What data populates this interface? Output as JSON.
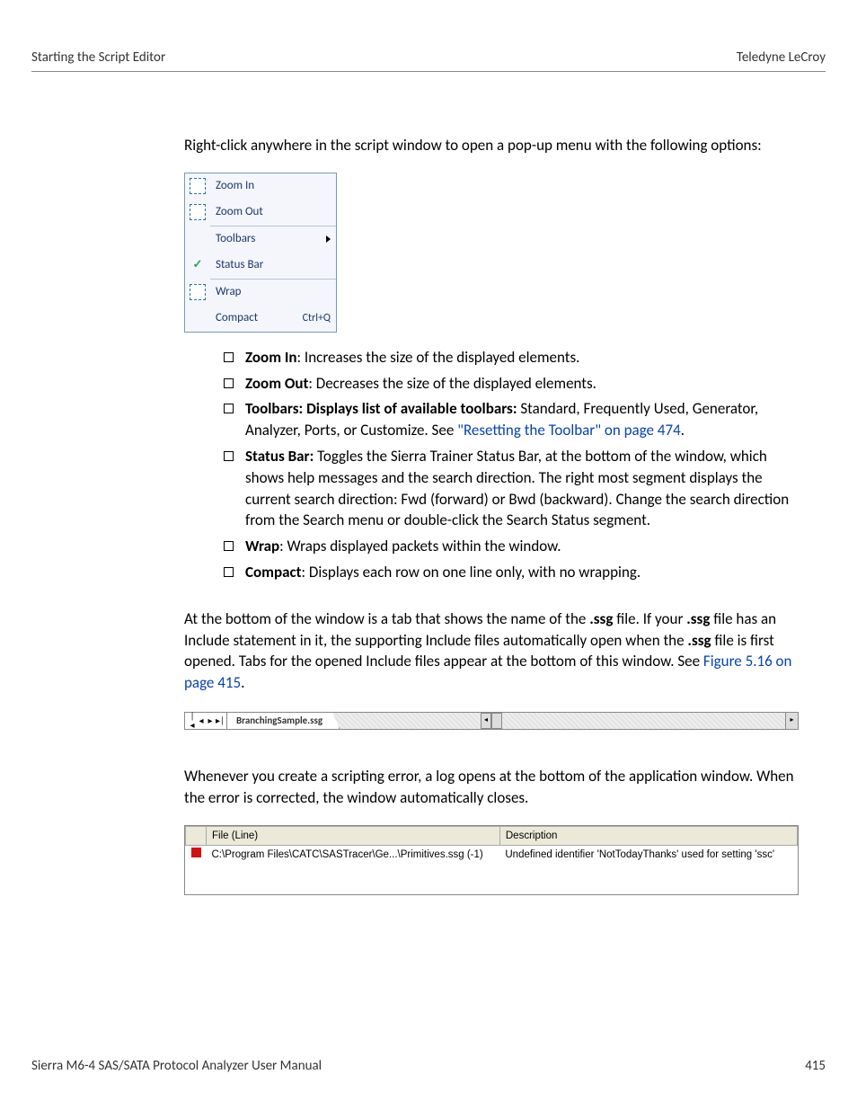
{
  "header": {
    "left": "Starting the Script Editor",
    "right": "Teledyne  LeCroy"
  },
  "intro": "Right-click anywhere in the script window to open a pop-up menu with the following options:",
  "menu": {
    "zoom_in": "Zoom In",
    "zoom_out": "Zoom Out",
    "toolbars": "Toolbars",
    "status_bar": "Status Bar",
    "wrap": "Wrap",
    "compact": "Compact",
    "compact_shortcut": "Ctrl+Q"
  },
  "bullets": {
    "zoom_in_label": "Zoom In",
    "zoom_in_text": ": Increases the size of the displayed elements.",
    "zoom_out_label": "Zoom Out",
    "zoom_out_text": ": Decreases the size of the displayed elements.",
    "toolbars_label": "Toolbars: Displays list of available toolbars:",
    "toolbars_text1": " Standard, Frequently Used, Generator, Analyzer, Ports, or Customize. See ",
    "toolbars_link": "\"Resetting the Toolbar\" on page 474",
    "toolbars_text2": ".",
    "statusbar_label": "Status Bar:",
    "statusbar_text": " Toggles the Sierra Trainer Status Bar, at the bottom of the window, which shows help messages and the search direction. The right most segment displays the current search direction: Fwd (forward) or Bwd (backward). Change the search direction from the Search menu or double-click the Search Status segment.",
    "wrap_label": "Wrap",
    "wrap_text": ": Wraps displayed packets within the window.",
    "compact_label": "Compact",
    "compact_text": ": Displays each row on one line only, with no wrapping."
  },
  "para2_a": "At the bottom of the window is a tab that shows the name of the ",
  "para2_b": " file. If your ",
  "para2_c": " file has an Include statement in it, the supporting Include files automatically open when the ",
  "para2_d": " file is first opened. Tabs for the opened Include files appear at the bottom of this window. See ",
  "ssg": ".ssg",
  "fig_link": "Figure 5.16 on page 415",
  "period": ".",
  "tab_name": "BranchingSample.ssg",
  "para3": "Whenever you create a scripting error, a log opens at the bottom of the application window. When the error is corrected, the window automatically closes.",
  "errlog": {
    "col1": "File (Line)",
    "col2": "Description",
    "file": "C:\\Program Files\\CATC\\SASTracer\\Ge...\\Primitives.ssg (-1)",
    "desc": "Undefined identifier 'NotTodayThanks' used for setting 'ssc'"
  },
  "footer": {
    "left": "Sierra M6-4 SAS/SATA Protocol Analyzer User Manual",
    "right": "415"
  }
}
